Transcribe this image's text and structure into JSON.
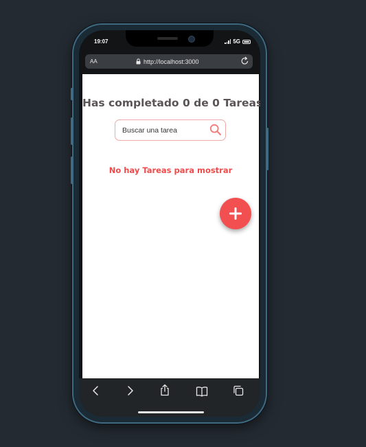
{
  "status_bar": {
    "time": "19:07",
    "network": "5G"
  },
  "browser": {
    "text_size_label": "AA",
    "url": "http://localhost:3000",
    "icons": {
      "lock": "lock-icon",
      "reload": "reload-icon"
    }
  },
  "app": {
    "title": "Has completado 0 de 0 Tareas",
    "search": {
      "placeholder": "Buscar una tarea",
      "value": ""
    },
    "empty_message": "No hay Tareas para mostrar",
    "add_button_icon": "plus-icon"
  },
  "toolbar": {
    "items": [
      "back-icon",
      "forward-icon",
      "share-icon",
      "bookmarks-icon",
      "tabs-icon"
    ]
  },
  "colors": {
    "accent": "#f25050",
    "search_border": "#f3a8a8",
    "title_text": "#5a5456",
    "background": "#232a31"
  }
}
